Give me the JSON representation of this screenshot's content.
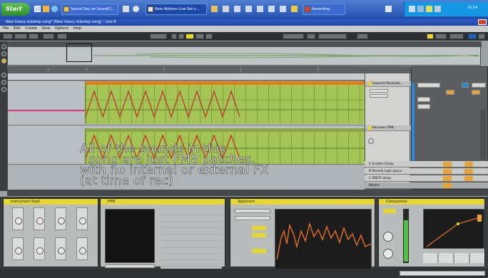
{
  "taskbar": {
    "start_label": "Start",
    "tasks": [
      {
        "label": "Sound Day on SoundCl..."
      },
      {
        "label": "New Ableton Live Set s..."
      },
      {
        "label": "Recording"
      }
    ],
    "clock": "10:54"
  },
  "window": {
    "title": "New heavy dubstep song* [New heavy dubstep song] - Live 8",
    "menu": [
      "File",
      "Edit",
      "Create",
      "View",
      "Options",
      "Help"
    ]
  },
  "caption_lines": [
    "All of the sounds in this",
    "song are just FM8 patches,",
    "with no internal or external FX",
    "(at time of rec)"
  ],
  "tracks": {
    "names": [
      "Frequent Modulati...",
      "Unknown FM8"
    ],
    "return_tracks": [
      "A Scatter Delay",
      "B Reverb high space",
      "C EMCR delay",
      "Master"
    ]
  },
  "devices": [
    {
      "title": "Instrument Rack"
    },
    {
      "title": "FM8"
    },
    {
      "title": "Spectrum"
    },
    {
      "title": "Compressor"
    }
  ],
  "colors": {
    "clip_green": "#a5c456",
    "clip_orange": "#e47a1a",
    "automation_red": "#d23a2a",
    "live_yellow": "#e7d631"
  }
}
